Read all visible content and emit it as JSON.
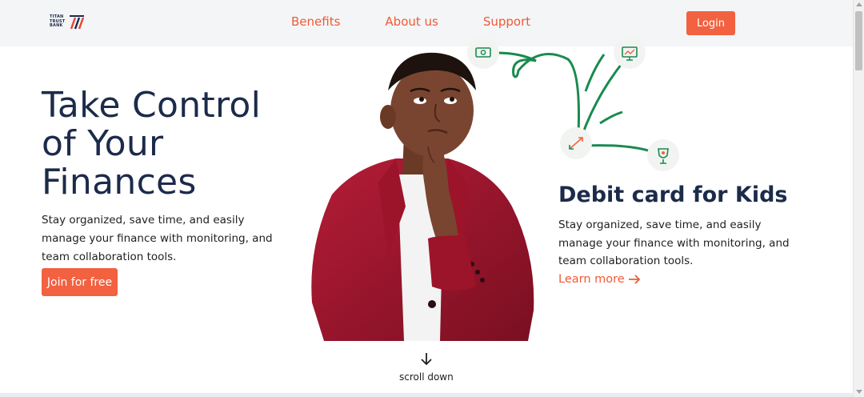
{
  "nav": {
    "logo_text": "TITAN\nTRUST\nBANK",
    "links": [
      "Benefits",
      "About us",
      "Support"
    ],
    "login_label": "Login"
  },
  "hero": {
    "title": "Take Control of Your Finances",
    "description": "Stay organized, save time, and easily manage your finance with monitoring, and team collaboration tools.",
    "cta_label": "Join for free"
  },
  "card": {
    "title": "Debit card for Kids",
    "description": "Stay organized, save time, and easily manage your finance with monitoring, and team collaboration tools.",
    "link_label": "Learn more"
  },
  "scroll": {
    "label": "scroll down"
  },
  "colors": {
    "accent": "#f26140",
    "navy": "#1c2b4a",
    "green": "#1a8a4f",
    "nav_bg": "#f4f5f7"
  },
  "icons": [
    "money-icon",
    "chart-monitor-icon",
    "transfer-arrows-icon",
    "trophy-icon",
    "arrow-right-icon",
    "arrow-down-icon"
  ]
}
